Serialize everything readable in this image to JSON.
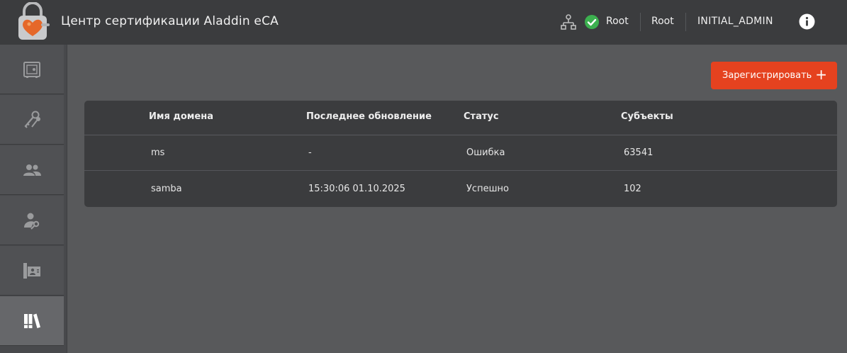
{
  "header": {
    "title": "Центр сертификации Aladdin eCA",
    "ca_status_name": "Root",
    "ca_root": "Root",
    "user": "INITIAL_ADMIN"
  },
  "sidebar": {
    "items": [
      {
        "icon": "safe-icon",
        "active": false
      },
      {
        "icon": "keys-icon",
        "active": false
      },
      {
        "icon": "users-icon",
        "active": false
      },
      {
        "icon": "user-key-icon",
        "active": false
      },
      {
        "icon": "directory-icon",
        "active": false
      },
      {
        "icon": "library-icon",
        "active": true
      }
    ]
  },
  "main": {
    "register_label": "Зарегистрировать",
    "register_plus": "+",
    "table": {
      "columns": [
        "Имя домена",
        "Последнее обновление",
        "Статус",
        "Субъекты"
      ],
      "rows": [
        [
          "ms",
          "-",
          "Ошибка",
          "63541"
        ],
        [
          "samba",
          "15:30:06 01.10.2025",
          "Успешно",
          "102"
        ]
      ]
    }
  },
  "colors": {
    "accent": "#e5421f",
    "ok": "#3cb04f",
    "header_bg": "#3b3c3e",
    "page_bg": "#58595b"
  }
}
